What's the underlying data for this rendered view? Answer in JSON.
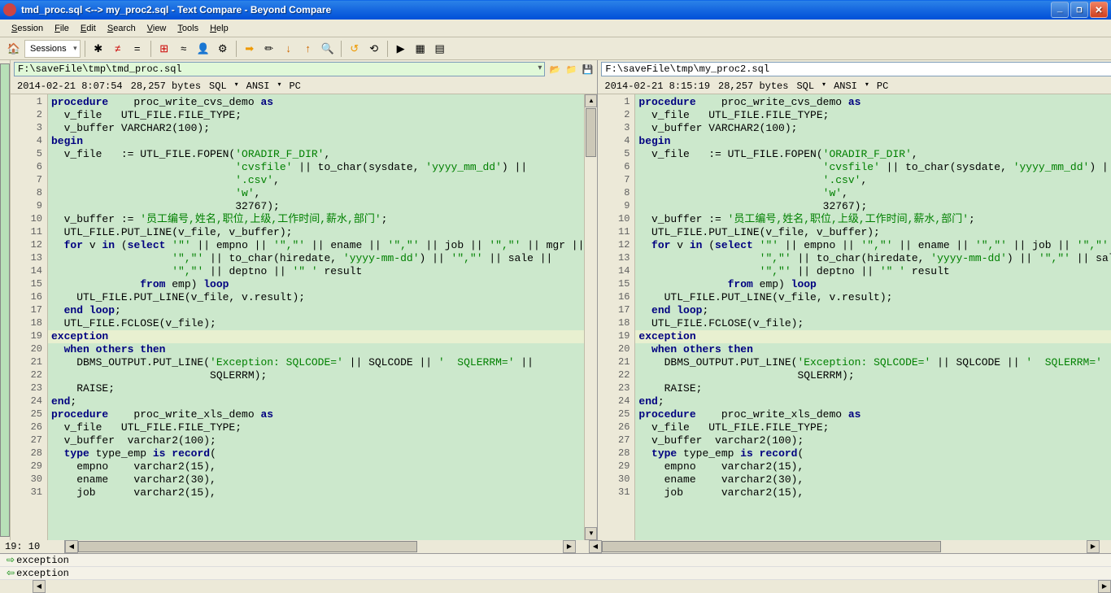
{
  "title": "tmd_proc.sql <--> my_proc2.sql - Text Compare - Beyond Compare",
  "menu": [
    "Session",
    "File",
    "Edit",
    "Search",
    "View",
    "Tools",
    "Help"
  ],
  "sessions_label": "Sessions",
  "left": {
    "path": "F:\\saveFile\\tmp\\tmd_proc.sql",
    "date": "2014-02-21 8:07:54",
    "bytes": "28,257 bytes",
    "lang": "SQL",
    "enc": "ANSI",
    "fmt": "PC"
  },
  "right": {
    "path": "F:\\saveFile\\tmp\\my_proc2.sql",
    "date": "2014-02-21 8:15:19",
    "bytes": "28,257 bytes",
    "lang": "SQL",
    "enc": "ANSI",
    "fmt": "PC"
  },
  "lines": [
    {
      "n": 1,
      "t": "procedure    proc_write_cvs_demo as"
    },
    {
      "n": 2,
      "t": "  v_file   UTL_FILE.FILE_TYPE;"
    },
    {
      "n": 3,
      "t": "  v_buffer VARCHAR2(100);"
    },
    {
      "n": 4,
      "t": "begin"
    },
    {
      "n": 5,
      "t": "  v_file   := UTL_FILE.FOPEN('ORADIR_F_DIR',"
    },
    {
      "n": 6,
      "t": "                             'cvsfile' || to_char(sysdate, 'yyyy_mm_dd') ||"
    },
    {
      "n": 7,
      "t": "                             '.csv',"
    },
    {
      "n": 8,
      "t": "                             'w',"
    },
    {
      "n": 9,
      "t": "                             32767);"
    },
    {
      "n": 10,
      "t": "  v_buffer := '员工编号,姓名,职位,上级,工作时间,薪水,部门';"
    },
    {
      "n": 11,
      "t": "  UTL_FILE.PUT_LINE(v_file, v_buffer);"
    },
    {
      "n": 12,
      "t": "  for v in (select '\"' || empno || '\",\"' || ename || '\",\"' || job || '\",\"' || mgr ||"
    },
    {
      "n": 13,
      "t": "                   '\",\"' || to_char(hiredate, 'yyyy-mm-dd') || '\",\"' || sale ||"
    },
    {
      "n": 14,
      "t": "                   '\",\"' || deptno || '\" ' result"
    },
    {
      "n": 15,
      "t": "              from emp) loop"
    },
    {
      "n": 16,
      "t": "    UTL_FILE.PUT_LINE(v_file, v.result);"
    },
    {
      "n": 17,
      "t": "  end loop;"
    },
    {
      "n": 18,
      "t": "  UTL_FILE.FCLOSE(v_file);"
    },
    {
      "n": 19,
      "t": "exception",
      "diff": true
    },
    {
      "n": 20,
      "t": "  when others then"
    },
    {
      "n": 21,
      "t": "    DBMS_OUTPUT.PUT_LINE('Exception: SQLCODE=' || SQLCODE || '  SQLERRM=' ||"
    },
    {
      "n": 22,
      "t": "                         SQLERRM);"
    },
    {
      "n": 23,
      "t": "    RAISE;"
    },
    {
      "n": 24,
      "t": "end;"
    },
    {
      "n": 25,
      "t": "procedure    proc_write_xls_demo as"
    },
    {
      "n": 26,
      "t": "  v_file   UTL_FILE.FILE_TYPE;"
    },
    {
      "n": 27,
      "t": "  v_buffer  varchar2(100);"
    },
    {
      "n": 28,
      "t": "  type type_emp is record("
    },
    {
      "n": 29,
      "t": "    empno    varchar2(15),"
    },
    {
      "n": 30,
      "t": "    ename    varchar2(30),"
    },
    {
      "n": 31,
      "t": "    job      varchar2(15),"
    }
  ],
  "cursor": "19: 10",
  "diff_lines": [
    "exception",
    "exception"
  ]
}
